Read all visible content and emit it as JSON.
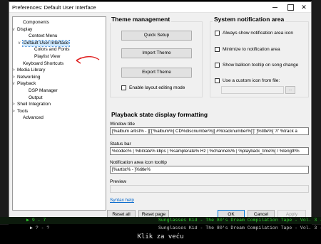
{
  "window": {
    "title": "Preferences: Default User Interface",
    "close_glyph": "✕"
  },
  "tree": [
    {
      "label": "Components",
      "expander": "",
      "indent": 1
    },
    {
      "label": "Display",
      "expander": "v",
      "indent": 0
    },
    {
      "label": "Context Menu",
      "expander": "",
      "indent": 2
    },
    {
      "label": "Default User Interface",
      "expander": "v",
      "indent": 1,
      "selected": true
    },
    {
      "label": "Colors and Fonts",
      "expander": "",
      "indent": 3
    },
    {
      "label": "Playlist View",
      "expander": "",
      "indent": 3
    },
    {
      "label": "Keyboard Shortcuts",
      "expander": "",
      "indent": 1
    },
    {
      "label": "Media Library",
      "expander": ">",
      "indent": 0
    },
    {
      "label": "Networking",
      "expander": ">",
      "indent": 0
    },
    {
      "label": "Playback",
      "expander": "v",
      "indent": 0
    },
    {
      "label": "DSP Manager",
      "expander": "",
      "indent": 2
    },
    {
      "label": "Output",
      "expander": "",
      "indent": 2
    },
    {
      "label": "Shell Integration",
      "expander": ">",
      "indent": 0
    },
    {
      "label": "Tools",
      "expander": ">",
      "indent": 0
    },
    {
      "label": "Advanced",
      "expander": "",
      "indent": 1
    }
  ],
  "theme": {
    "heading": "Theme management",
    "quick_setup": "Quick Setup",
    "import_theme": "Import Theme",
    "export_theme": "Export Theme",
    "layout_editing": "Enable layout editing mode"
  },
  "notification": {
    "heading": "System notification area",
    "always_show": "Always show notification area icon",
    "minimize": "Minimize to notification area",
    "balloon": "Show balloon tooltip on song change",
    "custom_icon": "Use a custom icon from file:",
    "browse": "..."
  },
  "playback": {
    "heading": "Playback state display formatting",
    "window_title_label": "Window title",
    "window_title_value": "[%album artist% - ]['['%album%[ CD%discnumber%][ #%tracknumber%]']' ]%title%[ '//' %track a",
    "status_bar_label": "Status bar",
    "status_bar_value": "%codec% | %bitrate% kbps | %samplerate% Hz | %channels% | %playback_time%[ / %length%",
    "tooltip_label": "Notification area icon tooltip",
    "tooltip_value": "[%artist% - ]%title%",
    "preview_label": "Preview",
    "syntax_help": "Syntax help"
  },
  "buttons": {
    "reset_all": "Reset all",
    "reset_page": "Reset page",
    "ok": "OK",
    "cancel": "Cancel",
    "apply": "Apply"
  },
  "background": {
    "row1_left": "▶ 9 - 7",
    "row1_right": "Sunglasses Kid - The 80's Dream Compilation Tape - Vol. 3 - 05 Knoc",
    "row2_left": "▶ ? - ?",
    "row2_right": "Sunglasses Kid - The 80's Dream Compilation Tape - Vol. 3 - 06 Knoc",
    "caption": "Klik za veću"
  },
  "colors": {
    "accent": "#0078d7",
    "link": "#0066cc",
    "annotation": "#e02020",
    "playing_row": "#2fd22f"
  }
}
